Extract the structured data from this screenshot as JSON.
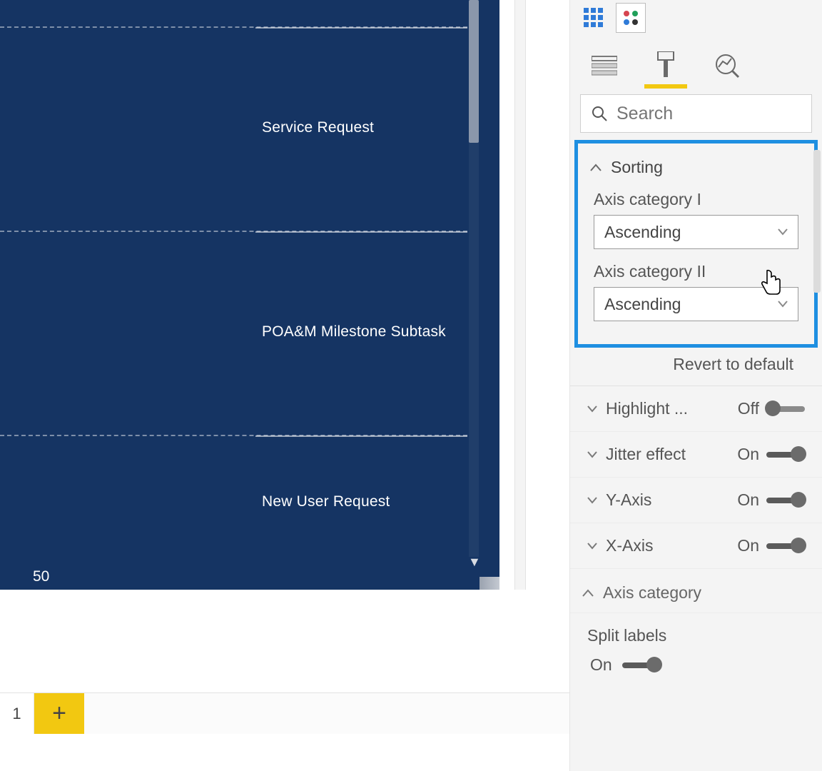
{
  "visual": {
    "rows": [
      {
        "label": "Service Request"
      },
      {
        "label": "POA&M Milestone Subtask"
      },
      {
        "label": "New User Request"
      }
    ],
    "x_tick": "50"
  },
  "page_tabs": {
    "active_suffix": "1",
    "add_glyph": "+"
  },
  "pane": {
    "search_placeholder": "Search",
    "sorting": {
      "title": "Sorting",
      "axis1": {
        "label": "Axis category I",
        "value": "Ascending"
      },
      "axis2": {
        "label": "Axis category II",
        "value": "Ascending"
      },
      "revert": "Revert to default"
    },
    "props": {
      "highlight": {
        "label": "Highlight ...",
        "state": "Off"
      },
      "jitter": {
        "label": "Jitter effect",
        "state": "On"
      },
      "yaxis": {
        "label": "Y-Axis",
        "state": "On"
      },
      "xaxis": {
        "label": "X-Axis",
        "state": "On"
      }
    },
    "axis_category": {
      "title": "Axis category",
      "split_labels": {
        "label": "Split labels",
        "state": "On"
      }
    }
  }
}
